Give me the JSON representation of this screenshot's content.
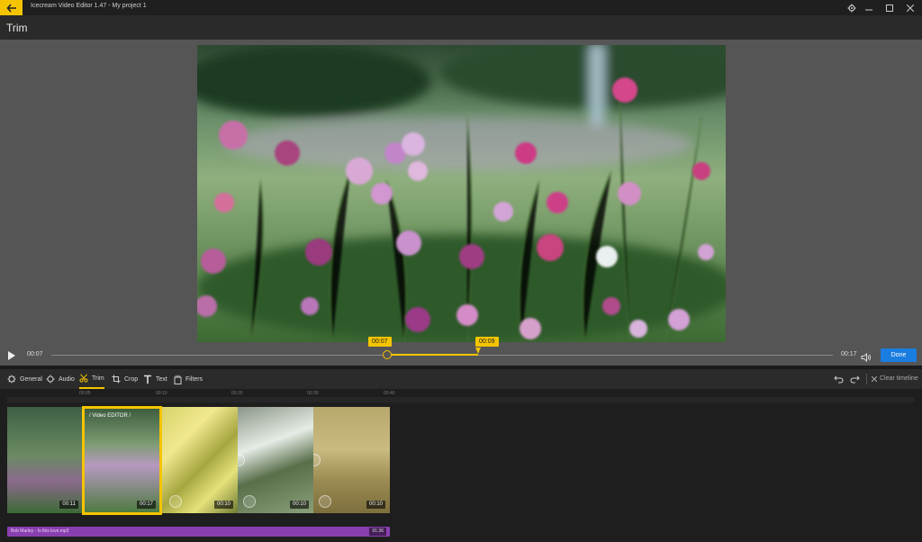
{
  "app": {
    "title": "Icecream Video Editor 1.47  -  My project 1",
    "header_title": "Trim"
  },
  "colors": {
    "accent": "#f5c400",
    "primary": "#1a7de0",
    "audio": "#8a3fb0"
  },
  "player": {
    "current_time": "00:07",
    "total_time": "00:17",
    "trim_start": "00:07",
    "trim_end": "00:09",
    "done_label": "Done"
  },
  "toolbar": {
    "tools": [
      {
        "label": "General",
        "icon": "gear-icon"
      },
      {
        "label": "Audio",
        "icon": "audio-settings-icon"
      },
      {
        "label": "Trim",
        "icon": "scissors-icon",
        "active": true
      },
      {
        "label": "Crop",
        "icon": "crop-icon"
      },
      {
        "label": "Text",
        "icon": "text-icon"
      },
      {
        "label": "Filters",
        "icon": "filters-icon"
      }
    ],
    "clear_label": "Clear timeline"
  },
  "timeline": {
    "ruler_marks": [
      "00:05",
      "00:10",
      "00:20",
      "00:30",
      "00:40"
    ],
    "clips": [
      {
        "name": "clip-1",
        "duration": "00:11"
      },
      {
        "name": "clip-2",
        "duration": "00:17",
        "label": "/ Video EDITOR /",
        "selected": true
      },
      {
        "name": "clip-3",
        "duration": "00:10"
      },
      {
        "name": "clip-4",
        "duration": "00:10"
      },
      {
        "name": "clip-5",
        "duration": "00:10"
      }
    ],
    "audio": {
      "name": "Bob Marley - Is this love.mp3",
      "duration": "01:36"
    }
  }
}
